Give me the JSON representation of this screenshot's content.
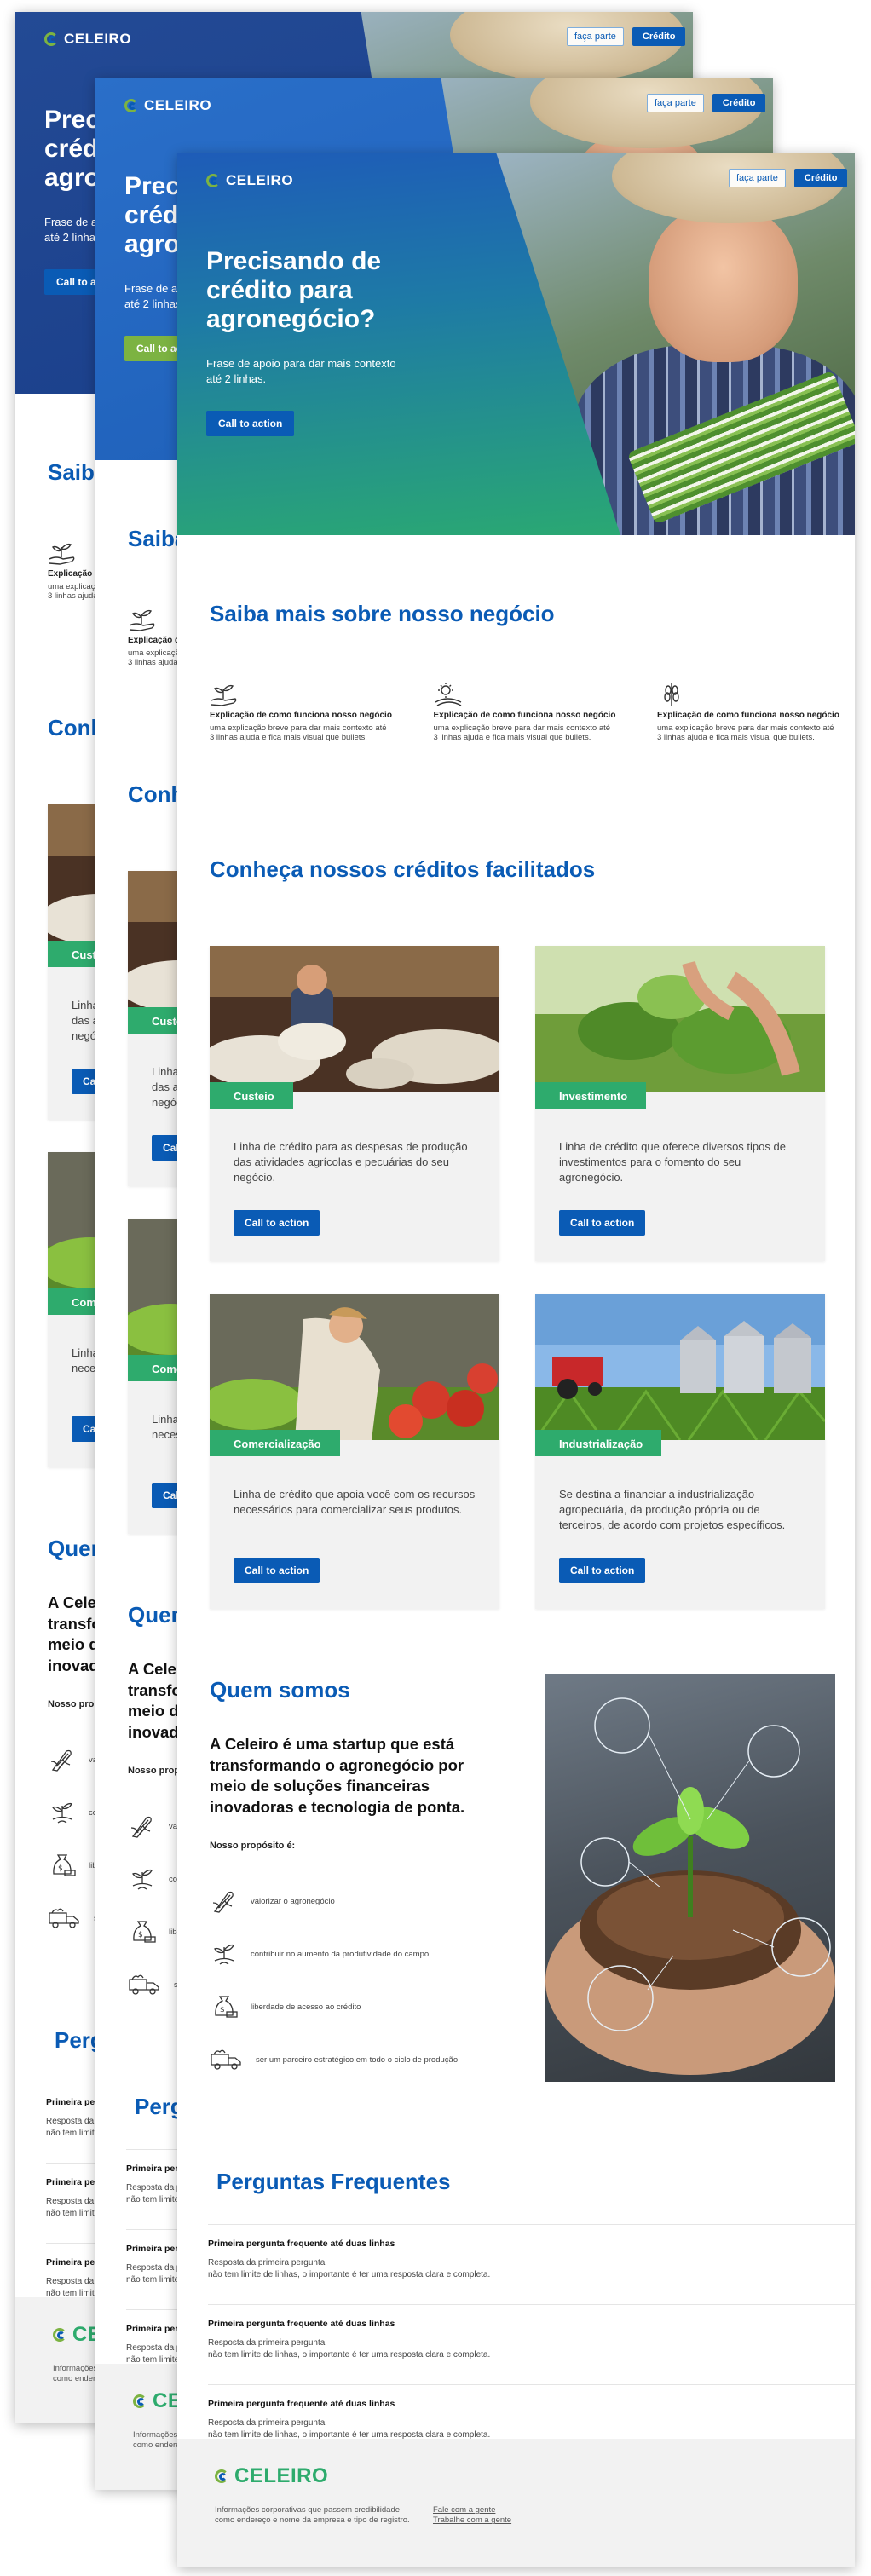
{
  "brand": {
    "name": "CELEIRO"
  },
  "nav": {
    "join_label": "faça parte",
    "credit_label": "Crédito"
  },
  "hero": {
    "title": "Precisando de crédito para agronegócio?",
    "subtitle": "Frase de apoio para dar mais contexto até 2 linhas.",
    "cta_label": "Call to action"
  },
  "about_business": {
    "title": "Saiba mais sobre nosso negócio",
    "features": [
      {
        "icon": "sprout-hand-icon",
        "title": "Explicação de como funciona nosso negócio",
        "text": "uma explicação breve para dar mais contexto até 3 linhas ajuda e fica mais visual que bullets."
      },
      {
        "icon": "sun-field-icon",
        "title": "Explicação de como funciona nosso negócio",
        "text": "uma explicação breve para dar mais contexto até 3 linhas ajuda e fica mais visual que bullets."
      },
      {
        "icon": "wheat-icon",
        "title": "Explicação de como funciona nosso negócio",
        "text": "uma explicação breve para dar mais contexto até 3 linhas ajuda e fica mais visual que bullets."
      }
    ]
  },
  "credits": {
    "title": "Conheça nossos créditos facilitados",
    "items": [
      {
        "tag": "Custeio",
        "text": "Linha de crédito para as despesas de produção das atividades agrícolas e pecuárias do seu negócio.",
        "cta": "Call to action"
      },
      {
        "tag": "Investimento",
        "text": "Linha de crédito que oferece diversos tipos de investimentos para o fomento do seu agronegócio.",
        "cta": "Call to action"
      },
      {
        "tag": "Comercialização",
        "text": "Linha de crédito que apoia você com os recursos necessários para comercializar seus produtos.",
        "cta": "Call to action"
      },
      {
        "tag": "Industrialização",
        "text": "Se destina a financiar a industrialização agropecuária, da produção própria ou de terceiros, de acordo com projetos específicos.",
        "cta": "Call to action"
      }
    ]
  },
  "who": {
    "title": "Quem somos",
    "lead": "A Celeiro é uma startup que está transformando o agronegócio por meio de soluções financeiras inovadoras e tecnologia de ponta.",
    "purpose_label": "Nosso propósito é:",
    "purposes": [
      {
        "icon": "corn-icon",
        "text": "valorizar o agronegócio"
      },
      {
        "icon": "plant-growth-icon",
        "text": "contribuir no aumento da produtividade do campo"
      },
      {
        "icon": "money-sack-icon",
        "text": "liberdade de acesso ao crédito"
      },
      {
        "icon": "truck-icon",
        "text": "ser um parceiro estratégico em todo o ciclo de produção"
      }
    ]
  },
  "faq": {
    "title": "Perguntas Frequentes",
    "items": [
      {
        "q": "Primeira pergunta frequente até duas linhas",
        "a1": "Resposta da primeira pergunta",
        "a2": "não tem limite de linhas, o importante é ter uma resposta clara e completa."
      },
      {
        "q": "Primeira pergunta frequente até duas linhas",
        "a1": "Resposta da primeira pergunta",
        "a2": "não tem limite de linhas, o importante é ter uma resposta clara e completa."
      },
      {
        "q": "Primeira pergunta frequente até duas linhas",
        "a1": "Resposta da primeira pergunta",
        "a2": "não tem limite de linhas, o importante é ter uma resposta clara e completa."
      }
    ]
  },
  "footer": {
    "info": "Informações corporativas que passem credibilidade como endereço e nome da empresa e tipo de registro.",
    "link1": "Fale com a gente",
    "link2": "Trabalhe com a gente"
  },
  "colors": {
    "blue": "#0a5bb5",
    "green": "#2eab6d",
    "lime": "#7cb342",
    "variant1_gradient": "#1a3f8a",
    "variant2_gradient": "#1e5fb8",
    "variant3_gradient": "#2eab6d"
  }
}
